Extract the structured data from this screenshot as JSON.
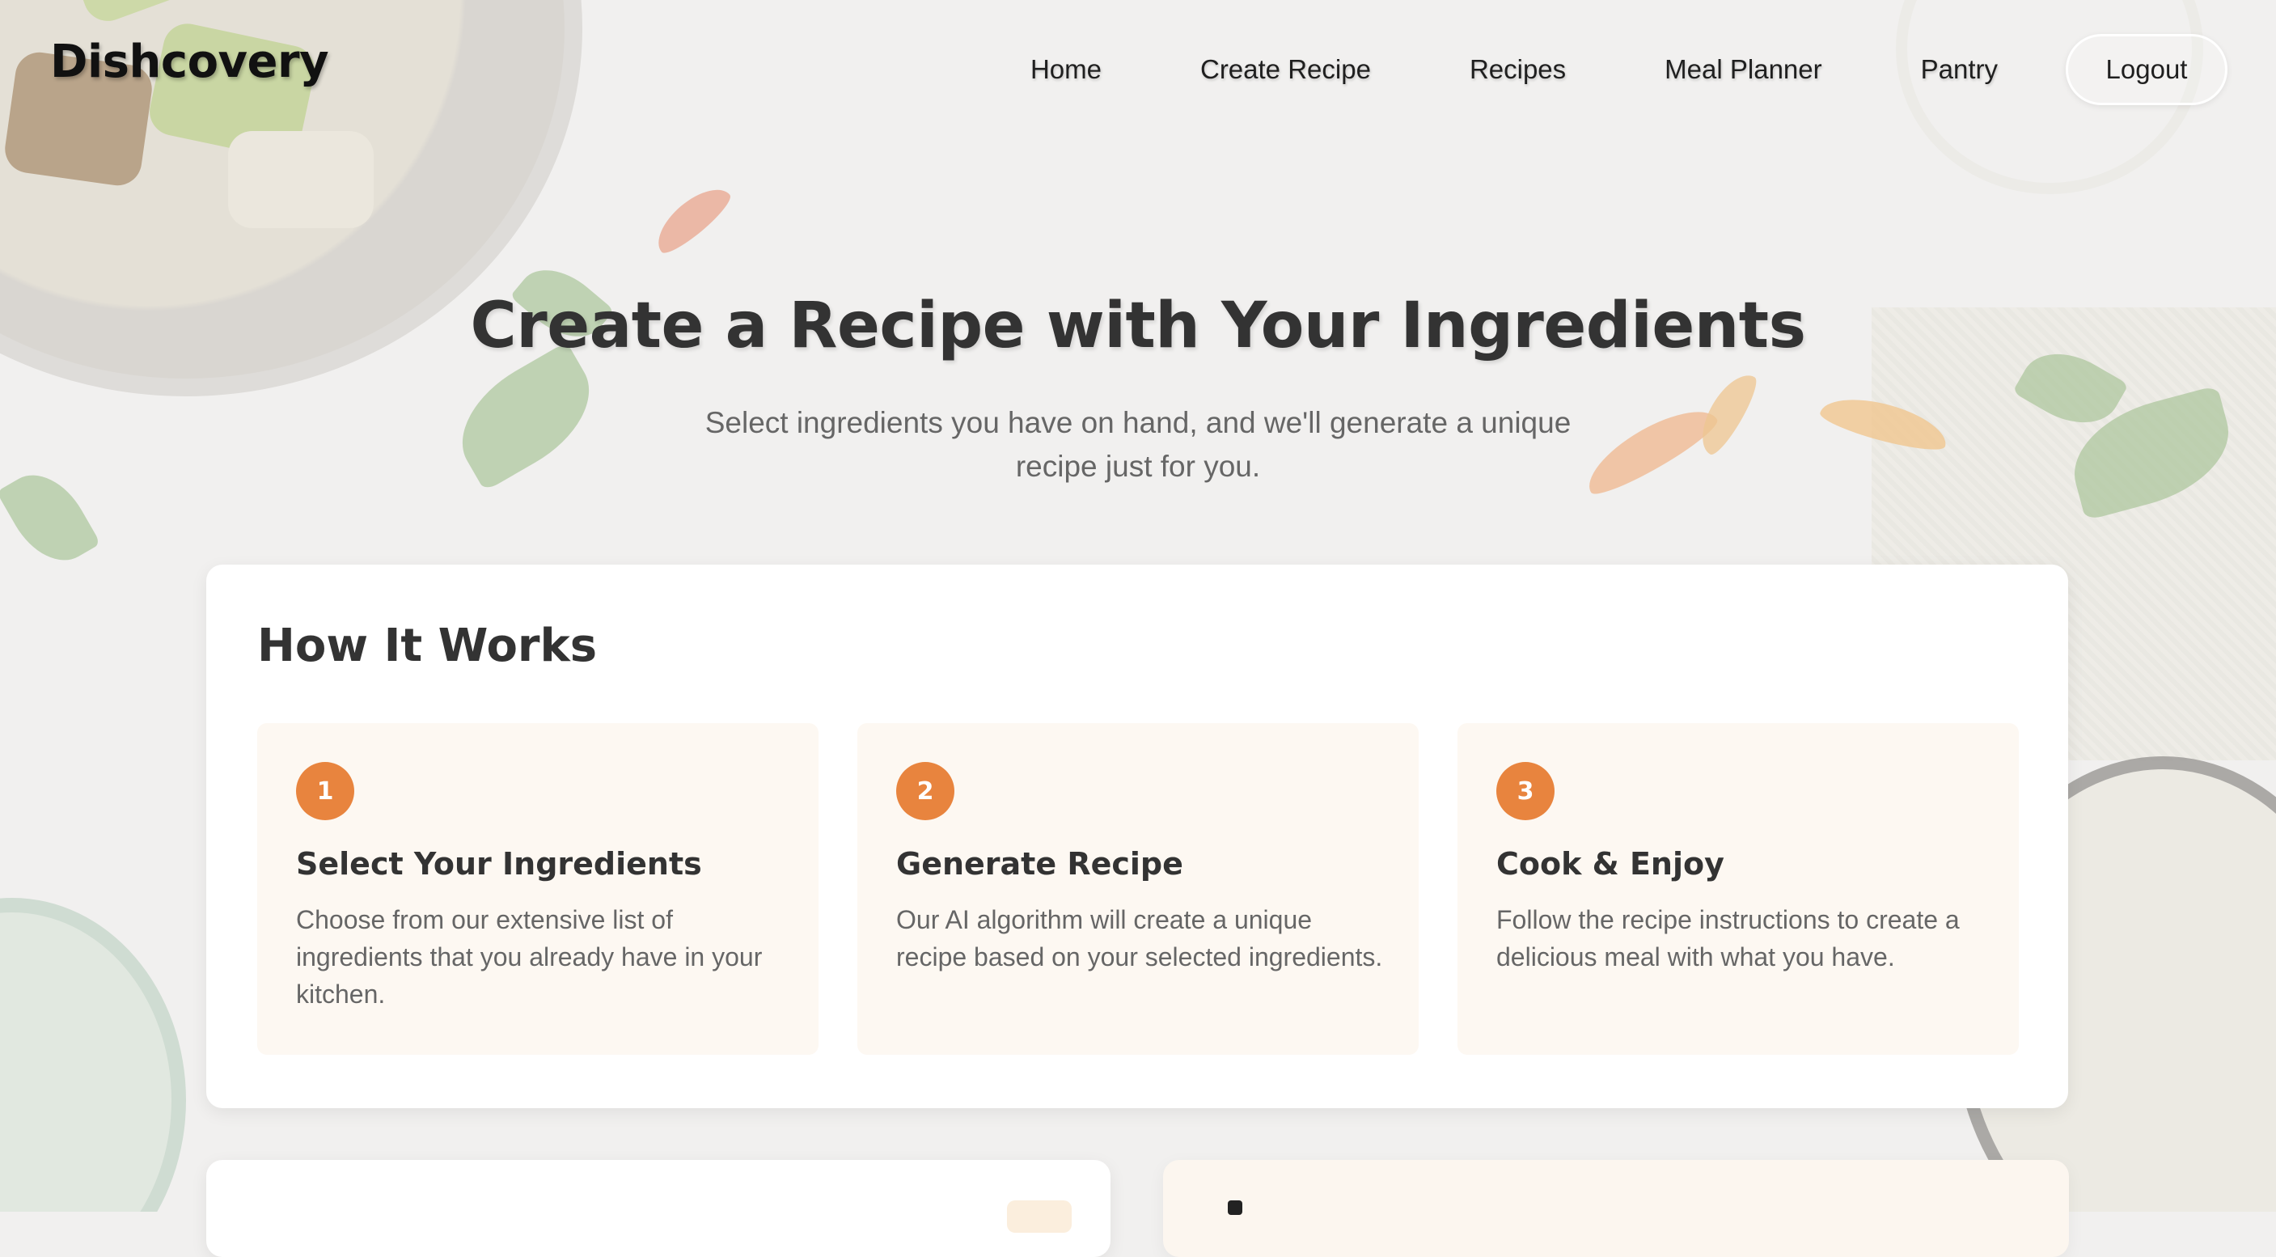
{
  "header": {
    "brand": "Dishcovery",
    "nav": [
      "Home",
      "Create Recipe",
      "Recipes",
      "Meal Planner",
      "Pantry"
    ],
    "logout_label": "Logout"
  },
  "hero": {
    "title": "Create a Recipe with Your Ingredients",
    "subtitle": "Select ingredients you have on hand, and we'll generate a unique recipe just for you."
  },
  "how_it_works": {
    "title": "How It Works",
    "steps": [
      {
        "number": "1",
        "title": "Select Your Ingredients",
        "description": "Choose from our extensive list of ingredients that you already have in your kitchen."
      },
      {
        "number": "2",
        "title": "Generate Recipe",
        "description": "Our AI algorithm will create a unique recipe based on your selected ingredients."
      },
      {
        "number": "3",
        "title": "Cook & Enjoy",
        "description": "Follow the recipe instructions to create a delicious meal with what you have."
      }
    ]
  },
  "colors": {
    "accent": "#e8843e",
    "step_background": "#fdf8f2",
    "text_primary": "#333333",
    "text_secondary": "#666666"
  }
}
